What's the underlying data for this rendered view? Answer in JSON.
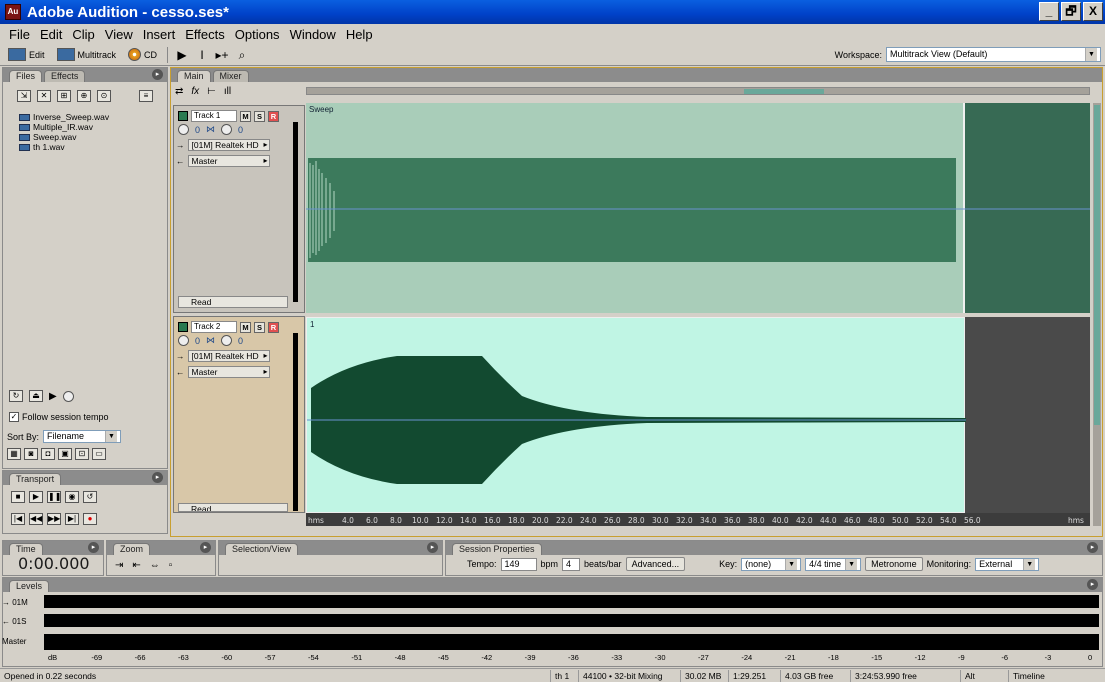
{
  "window": {
    "title": "Adobe Audition - cesso.ses*",
    "app_icon": "Au",
    "controls": [
      "_",
      "🗗",
      "X"
    ]
  },
  "menu": [
    "File",
    "Edit",
    "Clip",
    "View",
    "Insert",
    "Effects",
    "Options",
    "Window",
    "Help"
  ],
  "toolbar": {
    "edit_label": "Edit",
    "multitrack_label": "Multitrack",
    "cd_label": "CD",
    "workspace_label": "Workspace:",
    "workspace_value": "Multitrack View (Default)"
  },
  "files_panel": {
    "tabs": [
      "Files",
      "Effects"
    ],
    "files": [
      "Inverse_Sweep.wav",
      "Multiple_IR.wav",
      "Sweep.wav",
      "th 1.wav"
    ],
    "follow_tempo": "Follow session tempo",
    "sort_label": "Sort By:",
    "sort_value": "Filename"
  },
  "transport": {
    "tab": "Transport"
  },
  "main_tabs": [
    "Main",
    "Mixer"
  ],
  "tracks": [
    {
      "name": "Track 1",
      "vol": "0",
      "pan": "0",
      "input": "[01M] Realtek HD",
      "output": "Master",
      "automation": "Read",
      "clip_label": "Sweep",
      "color": "#a9cdb9"
    },
    {
      "name": "Track 2",
      "vol": "0",
      "pan": "0",
      "input": "[01M] Realtek HD",
      "output": "Master",
      "automation": "Read",
      "clip_label": "1",
      "color": "#c0f5e4"
    }
  ],
  "ruler": {
    "start": "hms",
    "end": "hms",
    "ticks": [
      "4.0",
      "6.0",
      "8.0",
      "10.0",
      "12.0",
      "14.0",
      "16.0",
      "18.0",
      "20.0",
      "22.0",
      "24.0",
      "26.0",
      "28.0",
      "30.0",
      "32.0",
      "34.0",
      "36.0",
      "38.0",
      "40.0",
      "42.0",
      "44.0",
      "46.0",
      "48.0",
      "50.0",
      "52.0",
      "54.0",
      "56.0"
    ]
  },
  "time_panel": {
    "tab": "Time",
    "value": "0:00.000"
  },
  "zoom_panel": {
    "tab": "Zoom"
  },
  "selection_panel": {
    "tab": "Selection/View"
  },
  "session": {
    "tab": "Session Properties",
    "tempo_label": "Tempo:",
    "tempo": "149",
    "bpm": "bpm",
    "beats": "4",
    "beats_label": "beats/bar",
    "advanced": "Advanced...",
    "key_label": "Key:",
    "key": "(none)",
    "time_sig": "4/4 time",
    "metronome": "Metronome",
    "monitoring_label": "Monitoring:",
    "monitoring": "External"
  },
  "levels": {
    "tab": "Levels",
    "rows": [
      "→ 01M",
      "← 01S",
      "Master"
    ],
    "scale": [
      "dB",
      "-69",
      "-66",
      "-63",
      "-60",
      "-57",
      "-54",
      "-51",
      "-48",
      "-45",
      "-42",
      "-39",
      "-36",
      "-33",
      "-30",
      "-27",
      "-24",
      "-21",
      "-18",
      "-15",
      "-12",
      "-9",
      "-6",
      "-3",
      "0"
    ]
  },
  "status": {
    "left": "Opened in 0.22 seconds",
    "track": "th 1",
    "format": "44100 • 32-bit Mixing",
    "size": "30.02 MB",
    "duration": "1:29.251",
    "free": "4.03 GB free",
    "free_time": "3:24:53.990 free",
    "alt": "Alt",
    "view": "Timeline"
  }
}
